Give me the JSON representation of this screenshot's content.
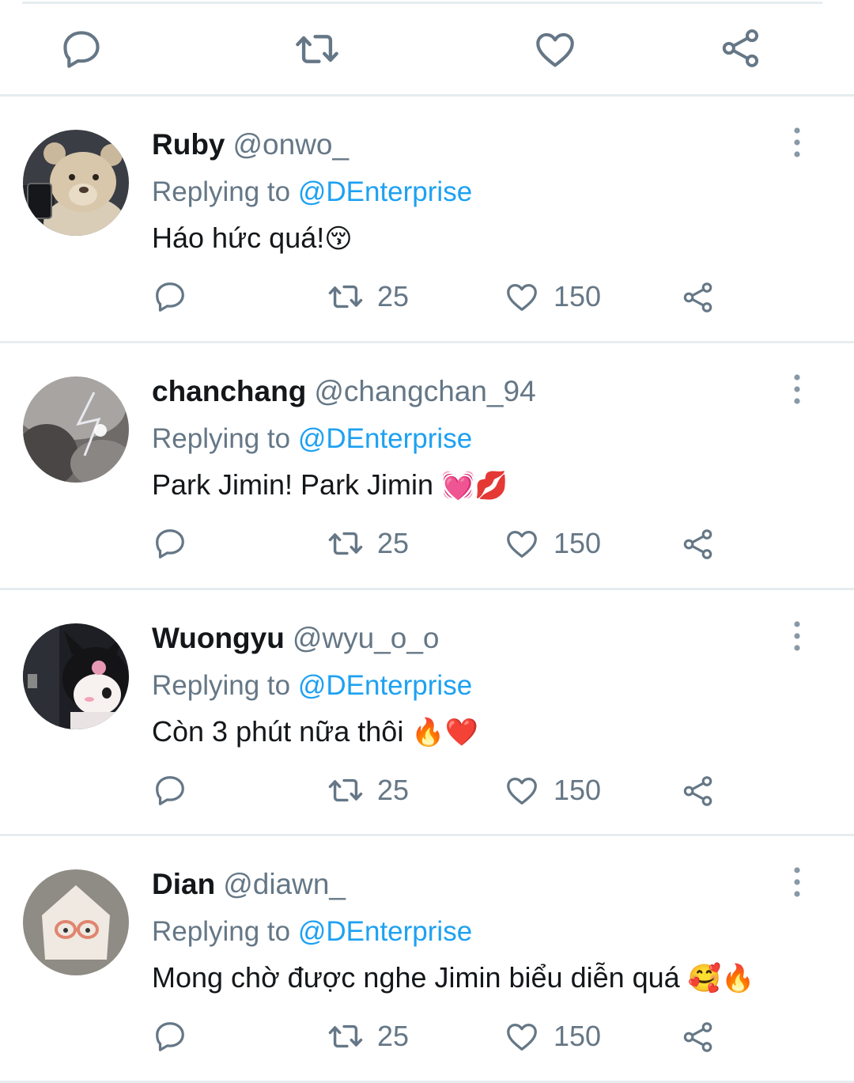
{
  "top_actions": {
    "icons": [
      "reply-icon",
      "retweet-icon",
      "like-icon",
      "share-icon"
    ]
  },
  "colors": {
    "muted": "#657786",
    "accent": "#1da1f2",
    "divider": "#e6ecf0",
    "text": "#14171a"
  },
  "tweets": [
    {
      "name": "Ruby",
      "handle": "@onwo_",
      "replying_prefix": "Replying to",
      "replying_to": "@DEnterprise",
      "text": "Háo hức quá!",
      "emoji": "😚",
      "retweets": "25",
      "likes": "150"
    },
    {
      "name": "chanchang",
      "handle": "@changchan_94",
      "replying_prefix": "Replying to",
      "replying_to": "@DEnterprise",
      "text": "Park Jimin! Park Jimin ",
      "emoji": "💓💋",
      "retweets": "25",
      "likes": "150"
    },
    {
      "name": "Wuongyu",
      "handle": "@wyu_o_o",
      "replying_prefix": "Replying to",
      "replying_to": "@DEnterprise",
      "text": "Còn 3 phút nữa thôi ",
      "emoji": "🔥❤️",
      "retweets": "25",
      "likes": "150"
    },
    {
      "name": "Dian",
      "handle": "@diawn_",
      "replying_prefix": "Replying to",
      "replying_to": "@DEnterprise",
      "text": "Mong chờ được nghe Jimin biểu diễn quá ",
      "emoji": "🥰🔥",
      "retweets": "25",
      "likes": "150"
    }
  ]
}
